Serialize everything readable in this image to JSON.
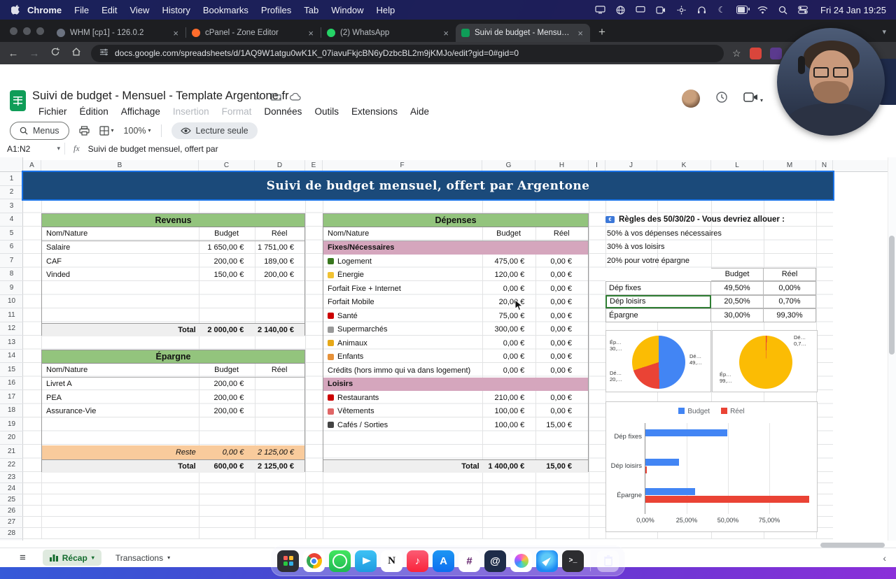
{
  "menubar": {
    "app": "Chrome",
    "items": [
      "File",
      "Edit",
      "View",
      "History",
      "Bookmarks",
      "Profiles",
      "Tab",
      "Window",
      "Help"
    ],
    "clock": "Fri 24 Jan 19:25",
    "status_icons": [
      "screen-mirroring",
      "globe",
      "display",
      "camera",
      "settings",
      "headphones",
      "moon",
      "battery",
      "wifi",
      "search",
      "control-center"
    ]
  },
  "browser": {
    "tabs": [
      {
        "title": "WHM [cp1] - 126.0.2"
      },
      {
        "title": "cPanel - Zone Editor"
      },
      {
        "title": "(2) WhatsApp"
      },
      {
        "title": "Suivi de budget - Mensuel -"
      }
    ],
    "url": "docs.google.com/spreadsheets/d/1AQ9W1atgu0wK1K_07iavuFkjcBN6yDzbcBL2m9jKMJo/edit?gid=0#gid=0"
  },
  "sheets": {
    "doc_title": "Suivi de budget - Mensuel - Template Argentone.fr",
    "menus": [
      "Fichier",
      "Édition",
      "Affichage",
      "Insertion",
      "Format",
      "Données",
      "Outils",
      "Extensions",
      "Aide"
    ],
    "toolbar": {
      "menus_label": "Menus",
      "zoom": "100%",
      "readonly_label": "Lecture seule"
    },
    "name_box": "A1:N2",
    "fx": "fx",
    "formula": "Suivi de budget mensuel, offert par",
    "banner": "Suivi de budget mensuel, offert par Argentone",
    "columns": [
      "A",
      "B",
      "C",
      "D",
      "E",
      "F",
      "G",
      "H",
      "I",
      "J",
      "K",
      "L",
      "M",
      "N"
    ],
    "row_count": 28,
    "sheet_tabs": {
      "recap": "Récap",
      "transactions": "Transactions"
    }
  },
  "revenus": {
    "title": "Revenus",
    "h_name": "Nom/Nature",
    "h_budget": "Budget",
    "h_reel": "Réel",
    "rows": [
      {
        "name": "Salaire",
        "budget": "1 650,00 €",
        "reel": "1 751,00 €"
      },
      {
        "name": "CAF",
        "budget": "200,00 €",
        "reel": "189,00 €"
      },
      {
        "name": "Vinded",
        "budget": "150,00 €",
        "reel": "200,00 €"
      }
    ],
    "total_label": "Total",
    "total_budget": "2 000,00 €",
    "total_reel": "2 140,00 €"
  },
  "epargne": {
    "title": "Épargne",
    "h_name": "Nom/Nature",
    "h_budget": "Budget",
    "h_reel": "Réel",
    "rows": [
      {
        "name": "Livret A",
        "budget": "200,00 €",
        "reel": ""
      },
      {
        "name": "PEA",
        "budget": "200,00 €",
        "reel": ""
      },
      {
        "name": "Assurance-Vie",
        "budget": "200,00 €",
        "reel": ""
      }
    ],
    "reste_label": "Reste",
    "reste_budget": "0,00 €",
    "reste_reel": "2 125,00 €",
    "total_label": "Total",
    "total_budget": "600,00 €",
    "total_reel": "2 125,00 €"
  },
  "depenses": {
    "title": "Dépenses",
    "h_name": "Nom/Nature",
    "h_budget": "Budget",
    "h_reel": "Réel",
    "section1": "Fixes/Nécessaires",
    "section2": "Loisirs",
    "rows": [
      {
        "name": "Logement",
        "icon_color": "#38761d",
        "budget": "475,00 €",
        "reel": "0,00 €"
      },
      {
        "name": "Énergie",
        "icon_color": "#f1c232",
        "budget": "120,00 €",
        "reel": "0,00 €"
      },
      {
        "name": "Forfait Fixe + Internet",
        "icon_color": "",
        "budget": "0,00 €",
        "reel": "0,00 €"
      },
      {
        "name": "Forfait Mobile",
        "icon_color": "",
        "budget": "20,00 €",
        "reel": "0,00 €"
      },
      {
        "name": "Santé",
        "icon_color": "#cc0000",
        "budget": "75,00 €",
        "reel": "0,00 €"
      },
      {
        "name": "Supermarchés",
        "icon_color": "#999999",
        "budget": "300,00 €",
        "reel": "0,00 €"
      },
      {
        "name": "Animaux",
        "icon_color": "#e6a817",
        "budget": "0,00 €",
        "reel": "0,00 €"
      },
      {
        "name": "Enfants",
        "icon_color": "#e69138",
        "budget": "0,00 €",
        "reel": "0,00 €"
      },
      {
        "name": "Crédits (hors immo qui va dans logement)",
        "icon_color": "",
        "budget": "0,00 €",
        "reel": "0,00 €"
      },
      {
        "name": "Restaurants",
        "icon_color": "#cc0000",
        "budget": "210,00 €",
        "reel": "0,00 €"
      },
      {
        "name": "Vêtements",
        "icon_color": "#e06666",
        "budget": "100,00 €",
        "reel": "0,00 €"
      },
      {
        "name": "Cafés / Sorties",
        "icon_color": "#434343",
        "budget": "100,00 €",
        "reel": "15,00 €"
      }
    ],
    "total_label": "Total",
    "total_budget": "1 400,00 €",
    "total_reel": "15,00 €"
  },
  "rules": {
    "title": "Règles des 50/30/20 - Vous devriez allouer :",
    "lines": [
      "50% à vos dépenses nécessaires",
      "30% à vos loisirs",
      "20% pour votre épargne"
    ],
    "h_budget": "Budget",
    "h_reel": "Réel",
    "rows": [
      {
        "name": "Dép fixes",
        "budget": "49,50%",
        "reel": "0,00%"
      },
      {
        "name": "Dép loisirs",
        "budget": "20,50%",
        "reel": "0,70%"
      },
      {
        "name": "Épargne",
        "budget": "30,00%",
        "reel": "99,30%"
      }
    ],
    "selected_row": "Dép loisirs"
  },
  "chart_data": [
    {
      "type": "pie",
      "name": "budget-allocation",
      "labels": [
        "Dép fixes",
        "Dép loisirs",
        "Épargne"
      ],
      "values": [
        49.5,
        20.5,
        30
      ],
      "slices": [
        {
          "color": "#4285f4",
          "pct": 49.5
        },
        {
          "color": "#ea4335",
          "pct": 20.5
        },
        {
          "color": "#fbbc04",
          "pct": 30
        }
      ],
      "visible_labels": [
        "Ép… 30,…",
        "Dé… 49,…",
        "Dé… 20,…"
      ]
    },
    {
      "type": "pie",
      "name": "reel-allocation",
      "labels": [
        "Dép fixes",
        "Dép loisirs",
        "Épargne"
      ],
      "values": [
        0,
        0.7,
        99.3
      ],
      "slices": [
        {
          "color": "#ea4335",
          "pct": 0.7
        },
        {
          "color": "#fbbc04",
          "pct": 99.3
        }
      ],
      "visible_labels": [
        "Dé… 0,7…",
        "Ép… 99,…"
      ]
    },
    {
      "type": "bar",
      "orientation": "horizontal",
      "categories": [
        "Dép fixes",
        "Dép loisirs",
        "Épargne"
      ],
      "series": [
        {
          "name": "Budget",
          "color": "#4285f4",
          "values": [
            49.5,
            20.5,
            30
          ]
        },
        {
          "name": "Réel",
          "color": "#ea4335",
          "values": [
            0,
            0.7,
            99.3
          ]
        }
      ],
      "xticks": [
        "0,00%",
        "25,00%",
        "50,00%",
        "75,00%"
      ],
      "xlim": [
        0,
        100
      ]
    }
  ],
  "dock": {
    "apps": [
      "launchpad",
      "chrome",
      "whatsapp",
      "telegram",
      "notion",
      "music",
      "app-store",
      "slack",
      "mail",
      "photos",
      "safari",
      "terminal",
      "trash"
    ]
  },
  "colors": {
    "banner": "#1b4a7a",
    "table_header_green": "#93c47d",
    "section_pink": "#d5a6bd",
    "reste_orange": "#f9cb9c",
    "accent_blue": "#1a73e8",
    "series_budget": "#4285f4",
    "series_reel": "#ea4335",
    "series_epargne": "#fbbc04"
  }
}
